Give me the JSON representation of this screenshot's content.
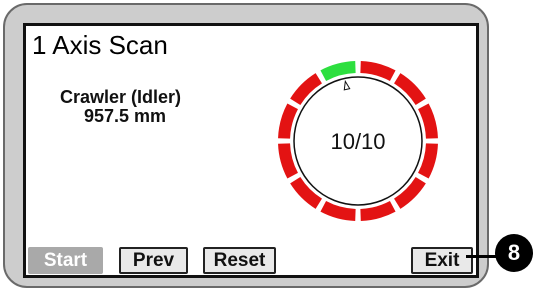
{
  "screen": {
    "title": "1 Axis Scan",
    "status_line1": "Crawler (Idler)",
    "status_line2": "957.5 mm"
  },
  "dial": {
    "label": "10/10",
    "segment_count": 12,
    "active_segment_index": 11,
    "active_color": "#2ddf3f",
    "inactive_color": "#e31313"
  },
  "buttons": {
    "start": "Start",
    "prev": "Prev",
    "reset": "Reset",
    "exit": "Exit"
  },
  "callout": {
    "number": "8"
  }
}
